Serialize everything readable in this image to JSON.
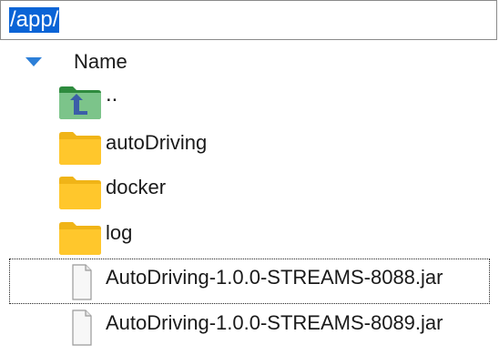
{
  "path_bar": {
    "value": "/app/"
  },
  "header": {
    "name_label": "Name"
  },
  "files": [
    {
      "name": "..",
      "kind": "parent-folder",
      "icon": "parent-folder-icon"
    },
    {
      "name": "autoDriving",
      "kind": "folder",
      "icon": "folder-icon"
    },
    {
      "name": "docker",
      "kind": "folder",
      "icon": "folder-icon"
    },
    {
      "name": "log",
      "kind": "folder",
      "icon": "folder-icon"
    },
    {
      "name": "AutoDriving-1.0.0-STREAMS-8088.jar",
      "kind": "file",
      "icon": "file-icon",
      "focused": true
    },
    {
      "name": "AutoDriving-1.0.0-STREAMS-8089.jar",
      "kind": "file",
      "icon": "file-icon"
    }
  ],
  "colors": {
    "selection": "#0a64d6",
    "folder": "#ffc72c",
    "folder_tab": "#f0b417",
    "parent_folder": "#7cc48a",
    "sort_arrow": "#2d7fd8"
  }
}
